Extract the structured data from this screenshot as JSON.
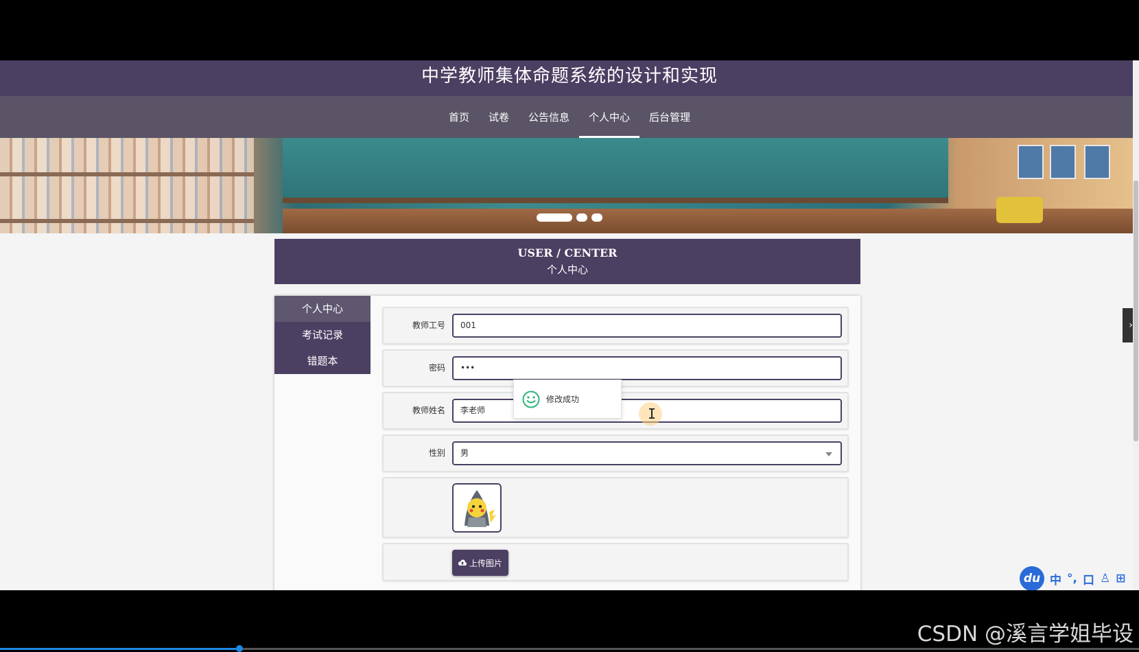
{
  "header": {
    "title": "中学教师集体命题系统的设计和实现"
  },
  "nav": {
    "items": [
      {
        "label": "首页",
        "active": false
      },
      {
        "label": "试卷",
        "active": false
      },
      {
        "label": "公告信息",
        "active": false
      },
      {
        "label": "个人中心",
        "active": true
      },
      {
        "label": "后台管理",
        "active": false
      }
    ]
  },
  "banner": {
    "dots": 3,
    "active_dot": 1
  },
  "user_center": {
    "title_en": "USER / CENTER",
    "title_zh": "个人中心"
  },
  "sidebar": {
    "items": [
      {
        "label": "个人中心",
        "active": true
      },
      {
        "label": "考试记录",
        "active": false
      },
      {
        "label": "错题本",
        "active": false
      }
    ]
  },
  "form": {
    "teacher_id": {
      "label": "教师工号",
      "value": "001"
    },
    "password": {
      "label": "密码",
      "value": "•••"
    },
    "teacher_name": {
      "label": "教师姓名",
      "value": "李老师"
    },
    "gender": {
      "label": "性别",
      "value": "男"
    },
    "upload_label": "上传图片"
  },
  "toast": {
    "message": "修改成功"
  },
  "ime": {
    "items": [
      "du",
      "中",
      "°,",
      "口",
      "♙",
      "⊞"
    ]
  },
  "video": {
    "progress_fraction": 0.21
  },
  "watermark": "CSDN @溪言学姐毕设",
  "colors": {
    "primary": "#4b3f62",
    "nav": "#5a5466",
    "accent_toast": "#2fb37a",
    "ime_blue": "#2a6bd8"
  }
}
